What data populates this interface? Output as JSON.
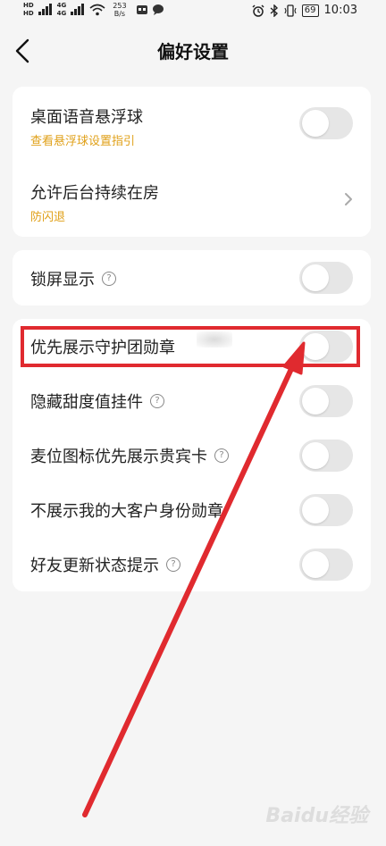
{
  "status_bar": {
    "sig1": "HD",
    "sig2": "HD",
    "net1": "4G",
    "net2": "4G",
    "speed_value": "253",
    "speed_unit": "B/s",
    "battery": "69",
    "time": "10:03"
  },
  "header": {
    "title": "偏好设置"
  },
  "card1": {
    "row1": {
      "label": "桌面语音悬浮球",
      "sub": "查看悬浮球设置指引"
    },
    "row2": {
      "label": "允许后台持续在房",
      "sub": "防闪退"
    }
  },
  "card2": {
    "row1": {
      "label": "锁屏显示"
    }
  },
  "card3": {
    "rows": [
      {
        "label": "优先展示守护团勋章"
      },
      {
        "label": "隐藏甜度值挂件"
      },
      {
        "label": "麦位图标优先展示贵宾卡"
      },
      {
        "label": "不展示我的大客户身份勋章"
      },
      {
        "label": "好友更新状态提示"
      }
    ]
  },
  "icons": {
    "help": "?"
  },
  "watermark": "Baidu经验",
  "colors": {
    "accent_sub": "#e0a018",
    "annotation": "#e02a2f",
    "toggle_off": "#e6e6e6"
  }
}
